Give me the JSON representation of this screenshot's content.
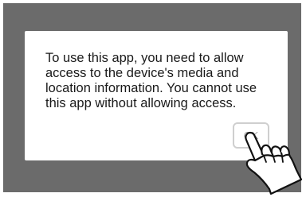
{
  "dialog": {
    "message_lines": [
      "To use this app, you need to allow",
      "access to the device's media and",
      "location information. You cannot use",
      "this app without allowing access."
    ],
    "ok_label": "OK"
  },
  "icons": {
    "tap_hand": "pointing-hand-icon"
  }
}
